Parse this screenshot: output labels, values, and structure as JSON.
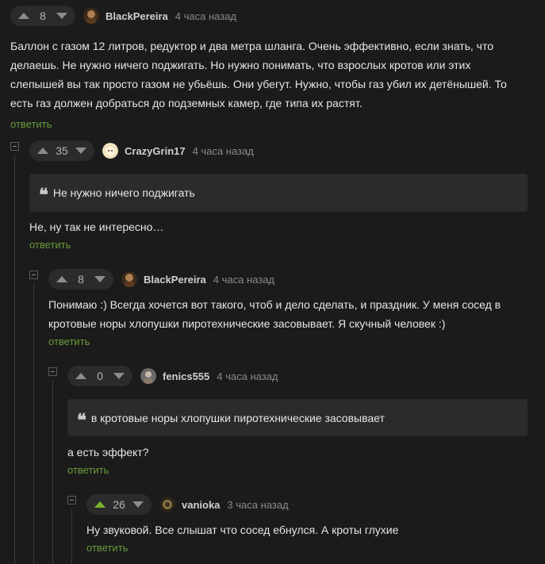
{
  "comments": [
    {
      "score": "8",
      "author": "BlackPereira",
      "time": "4 часа назад",
      "text_lines": [
        "Баллон с газом 12 литров, редуктор и два метра шланга. Очень эффективно, если знать, что",
        "делаешь. Не нужно ничего поджигать. Но нужно понимать, что взрослых кротов или этих",
        "слепышей вы так просто газом не убьёшь. Они убегут. Нужно, чтобы газ убил их детёнышей. То",
        "есть газ должен добраться до подземных камер, где типа их растят."
      ],
      "reply": "ответить"
    },
    {
      "score": "35",
      "author": "CrazyGrin17",
      "time": "4 часа назад",
      "quote": "Не нужно ничего поджигать",
      "text_lines": [
        "Не, ну так не интересно…"
      ],
      "reply": "ответить"
    },
    {
      "score": "8",
      "author": "BlackPereira",
      "time": "4 часа назад",
      "text_lines": [
        "Понимаю :) Всегда хочется вот такого, чтоб и дело сделать, и праздник. У меня сосед в",
        "кротовые норы хлопушки пиротехнические засовывает. Я скучный человек :)"
      ],
      "reply": "ответить"
    },
    {
      "score": "0",
      "author": "fenics555",
      "time": "4 часа назад",
      "quote": "в кротовые норы хлопушки пиротехнические засовывает",
      "text_lines": [
        "а есть эффект?"
      ],
      "reply": "ответить"
    },
    {
      "score": "26",
      "author": "vanioka",
      "time": "3 часа назад",
      "text_lines": [
        "Ну звуковой. Все слышат что сосед ебнулся. А кроты глухие"
      ],
      "reply": "ответить"
    }
  ],
  "icons": {
    "upvote": "upvote-arrow-icon",
    "downvote": "downvote-arrow-icon",
    "quote": "quote-icon",
    "collapse": "collapse-minus-icon"
  },
  "colors": {
    "background": "#1b1b1b",
    "panel": "#2b2b2b",
    "reply_link": "#6a9c3a",
    "upvote_active": "#7bb32e"
  },
  "quote_glyph": "❝"
}
